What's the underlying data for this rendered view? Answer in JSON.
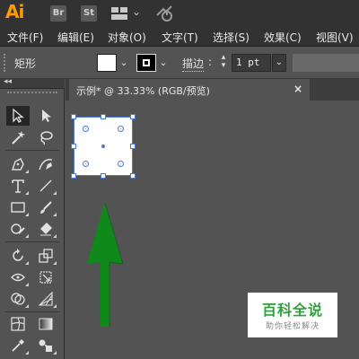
{
  "app": {
    "logo": "Ai",
    "bridge_label": "Br",
    "stock_label": "St"
  },
  "menu": {
    "items": [
      "文件(F)",
      "编辑(E)",
      "对象(O)",
      "文字(T)",
      "选择(S)",
      "效果(C)",
      "视图(V)"
    ]
  },
  "control_bar": {
    "selection_label": "矩形",
    "stroke_label": "描边",
    "stroke_colon": ":",
    "stroke_weight": "1 pt",
    "fill_color": "#ffffff",
    "stroke_color": "#000000"
  },
  "document": {
    "tab_title": "示例* @ 33.33% (RGB/预览)",
    "close_symbol": "×"
  },
  "toolbar": {
    "collapse_symbol": "◂◂",
    "tools": [
      "selection-tool",
      "direct-selection-tool",
      "magic-wand-tool",
      "lasso-tool",
      "pen-tool",
      "curvature-tool",
      "type-tool",
      "line-segment-tool",
      "rectangle-tool",
      "paintbrush-tool",
      "shaper-tool",
      "eraser-tool",
      "rotate-tool",
      "scale-tool",
      "width-tool",
      "free-transform-tool",
      "shape-builder-tool",
      "perspective-grid-tool",
      "mesh-tool",
      "gradient-tool",
      "eyedropper-tool",
      "blend-tool"
    ]
  },
  "canvas": {
    "arrow_color": "#0f8a1a",
    "selection_color": "#4a78d6"
  },
  "watermark": {
    "title": "百科全说",
    "subtitle": "助你轻松解决"
  }
}
